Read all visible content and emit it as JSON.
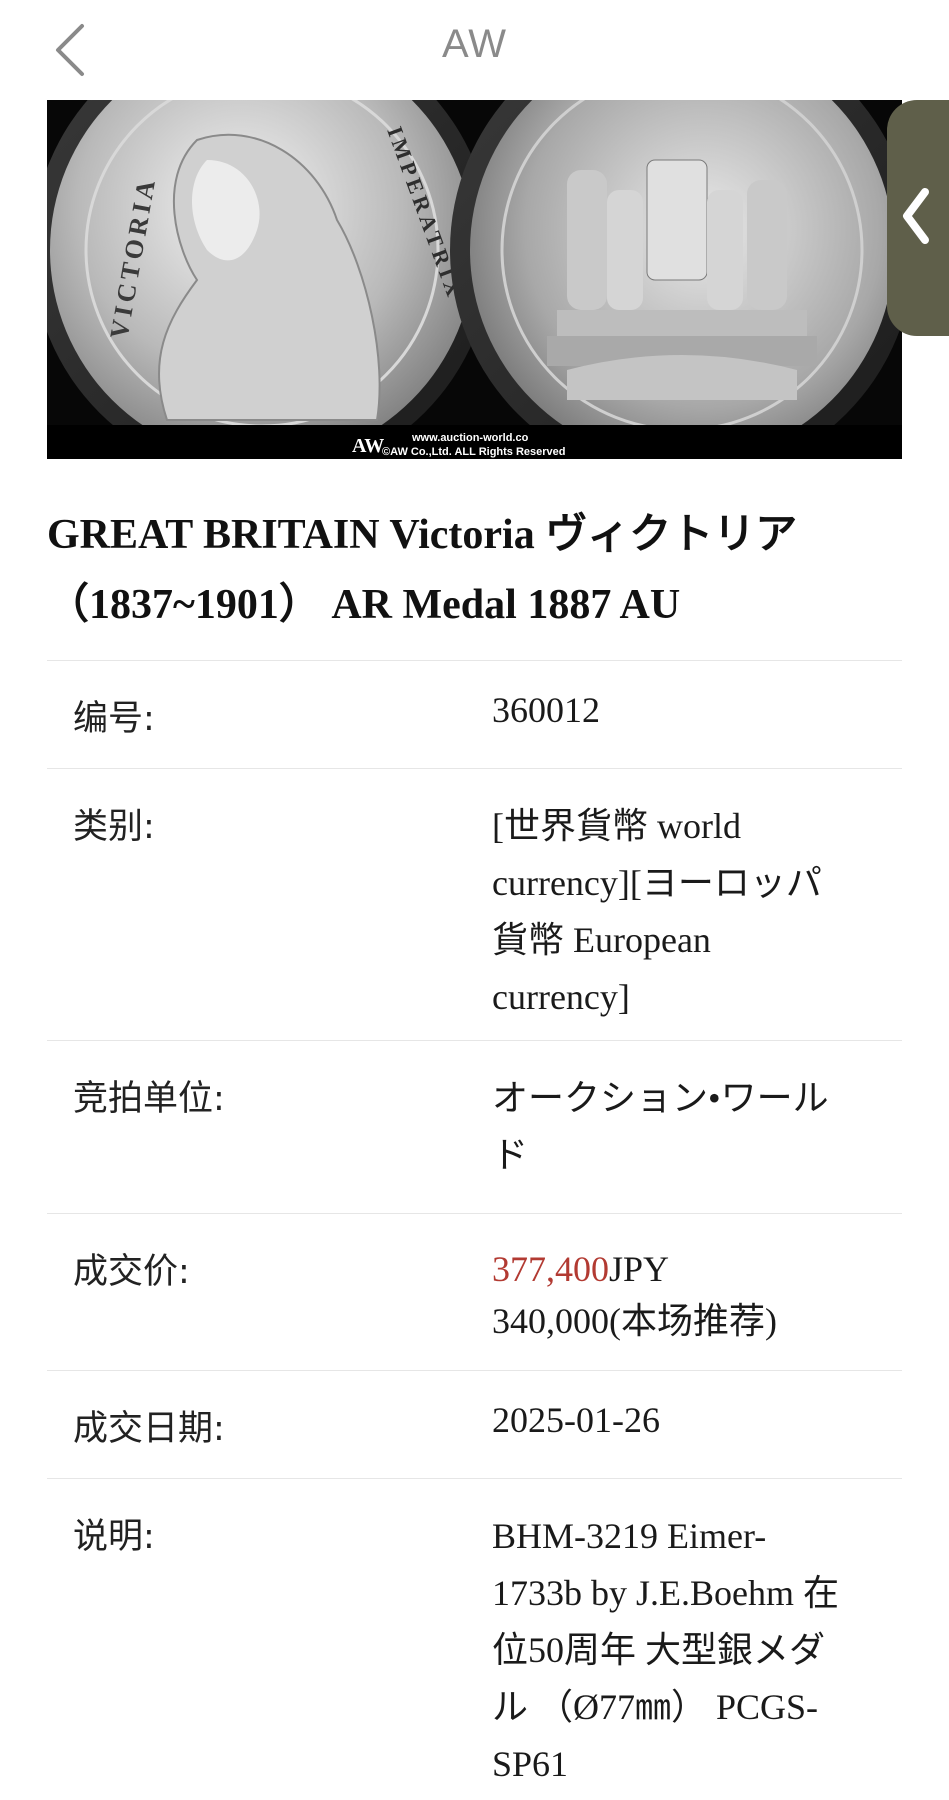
{
  "nav": {
    "title": "AW",
    "back_icon": "chevron-left-icon",
    "side_handle_icon": "chevron-left-icon",
    "side_handle_color": "#5f5f4a"
  },
  "image": {
    "watermark_logo": "AW",
    "watermark_url": "www.auction-world.co",
    "watermark_copyright": "©AW Co.,Ltd. ALL Rights Reserved",
    "obverse_legend_left": "VICTORIA",
    "obverse_legend_right": "IMPERATRIX"
  },
  "lot": {
    "title_line1": "GREAT BRITAIN Victoria ヴィクトリア",
    "title_line2": "（1837~1901） AR Medal 1887 AU"
  },
  "details": {
    "number": {
      "label": "编号:",
      "value": "360012"
    },
    "category": {
      "label": "类别:",
      "lines": [
        "[世界貨幣 world",
        "currency][ヨーロッパ",
        "貨幣 European",
        "currency]"
      ]
    },
    "auction_house": {
      "label": "竞拍单位:",
      "lines": [
        "オークション•ワール",
        "ド"
      ]
    },
    "price": {
      "label": "成交价:",
      "amount": "377,400",
      "currency": "JPY",
      "recommended": "340,000(本场推荐)",
      "amount_color": "#b23a32"
    },
    "date": {
      "label": "成交日期:",
      "value": "2025-01-26"
    },
    "description": {
      "label": "说明:",
      "lines": [
        "BHM-3219 Eimer-",
        "1733b by J.E.Boehm 在",
        "位50周年 大型銀メダ",
        "ル （Ø77㎜） PCGS-",
        "SP61"
      ]
    }
  }
}
